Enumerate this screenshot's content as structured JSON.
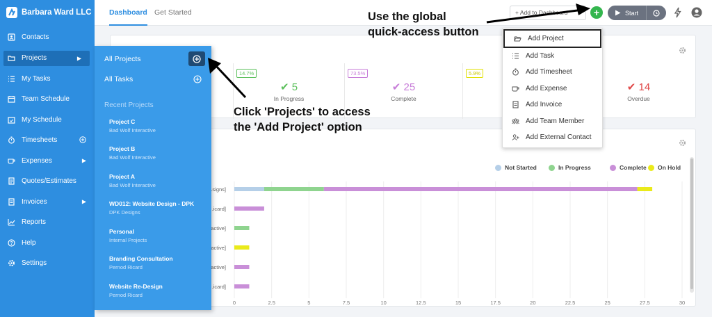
{
  "brand": {
    "name": "Barbara Ward LLC"
  },
  "sidebar": {
    "items": [
      {
        "label": "Contacts",
        "icon": "contacts-icon"
      },
      {
        "label": "Projects",
        "icon": "folder-icon"
      },
      {
        "label": "My Tasks",
        "icon": "tasks-icon"
      },
      {
        "label": "Team Schedule",
        "icon": "calendar-icon"
      },
      {
        "label": "My Schedule",
        "icon": "calendar-check-icon"
      },
      {
        "label": "Timesheets",
        "icon": "stopwatch-icon"
      },
      {
        "label": "Expenses",
        "icon": "cup-icon"
      },
      {
        "label": "Quotes/Estimates",
        "icon": "document-icon"
      },
      {
        "label": "Invoices",
        "icon": "invoice-icon"
      },
      {
        "label": "Reports",
        "icon": "chart-icon"
      },
      {
        "label": "Help",
        "icon": "question-icon"
      },
      {
        "label": "Settings",
        "icon": "gear-icon"
      }
    ]
  },
  "topbar": {
    "tabs": [
      "Dashboard",
      "Get Started"
    ],
    "add_dashboard": "+ Add to Dashboard",
    "start_label": "Start"
  },
  "stats": [
    {
      "badge": "14.7%",
      "value": "5",
      "label": "In Progress",
      "color": "#5cc05c"
    },
    {
      "badge": "73.5%",
      "value": "25",
      "label": "Complete",
      "color": "#c77dd8"
    },
    {
      "badge": "5.9%",
      "value": "",
      "label": "",
      "color": "#e0e000"
    },
    {
      "badge": "",
      "value": "14",
      "label": "Overdue",
      "color": "#e04848"
    }
  ],
  "chart_data": {
    "type": "bar",
    "orientation": "horizontal",
    "stacked": true,
    "categories": [
      "...signs]",
      "...icard]",
      "...active]",
      "...active]",
      "...active]",
      "...icard]"
    ],
    "series": [
      {
        "name": "Not Started",
        "color": "#b5cfe8",
        "values": [
          2,
          0,
          0,
          0,
          0,
          0
        ]
      },
      {
        "name": "In Progress",
        "color": "#8fd48f",
        "values": [
          4,
          0,
          1,
          0,
          0,
          0
        ]
      },
      {
        "name": "Complete",
        "color": "#c98fd8",
        "values": [
          21,
          2,
          0,
          0,
          1,
          1
        ]
      },
      {
        "name": "On Hold",
        "color": "#eaea1a",
        "values": [
          1,
          0,
          0,
          1,
          0,
          0
        ]
      }
    ],
    "x_ticks": [
      "0",
      "2.5",
      "5",
      "7.5",
      "10",
      "12.5",
      "15",
      "17.5",
      "20",
      "22.5",
      "25",
      "27.5",
      "30"
    ],
    "xlim": [
      0,
      30
    ],
    "legend_position": "top-right"
  },
  "flyout": {
    "all_projects": "All Projects",
    "all_tasks": "All Tasks",
    "recent_title": "Recent Projects",
    "projects": [
      {
        "name": "Project C",
        "client": "Bad Wolf Interactive"
      },
      {
        "name": "Project B",
        "client": "Bad Wolf Interactive"
      },
      {
        "name": "Project A",
        "client": "Bad Wolf Interactive"
      },
      {
        "name": "WD012: Website Design - DPK",
        "client": "DPK Designs"
      },
      {
        "name": "Personal",
        "client": "Internal Projects"
      },
      {
        "name": "Branding Consultation",
        "client": "Pernod Ricard"
      },
      {
        "name": "Website Re-Design",
        "client": "Pernod Ricard"
      }
    ]
  },
  "dropdown": {
    "items": [
      {
        "label": "Add Project",
        "icon": "folder-open-icon"
      },
      {
        "label": "Add Task",
        "icon": "list-icon"
      },
      {
        "label": "Add Timesheet",
        "icon": "stopwatch-icon"
      },
      {
        "label": "Add Expense",
        "icon": "cup-icon"
      },
      {
        "label": "Add Invoice",
        "icon": "invoice-icon"
      },
      {
        "label": "Add Team Member",
        "icon": "team-icon"
      },
      {
        "label": "Add External Contact",
        "icon": "user-plus-icon"
      }
    ]
  },
  "annotations": {
    "global_line1": "Use the global",
    "global_line2": "quick-access button",
    "projects_line1": "Click 'Projects' to access",
    "projects_line2": "the 'Add Project' option"
  }
}
